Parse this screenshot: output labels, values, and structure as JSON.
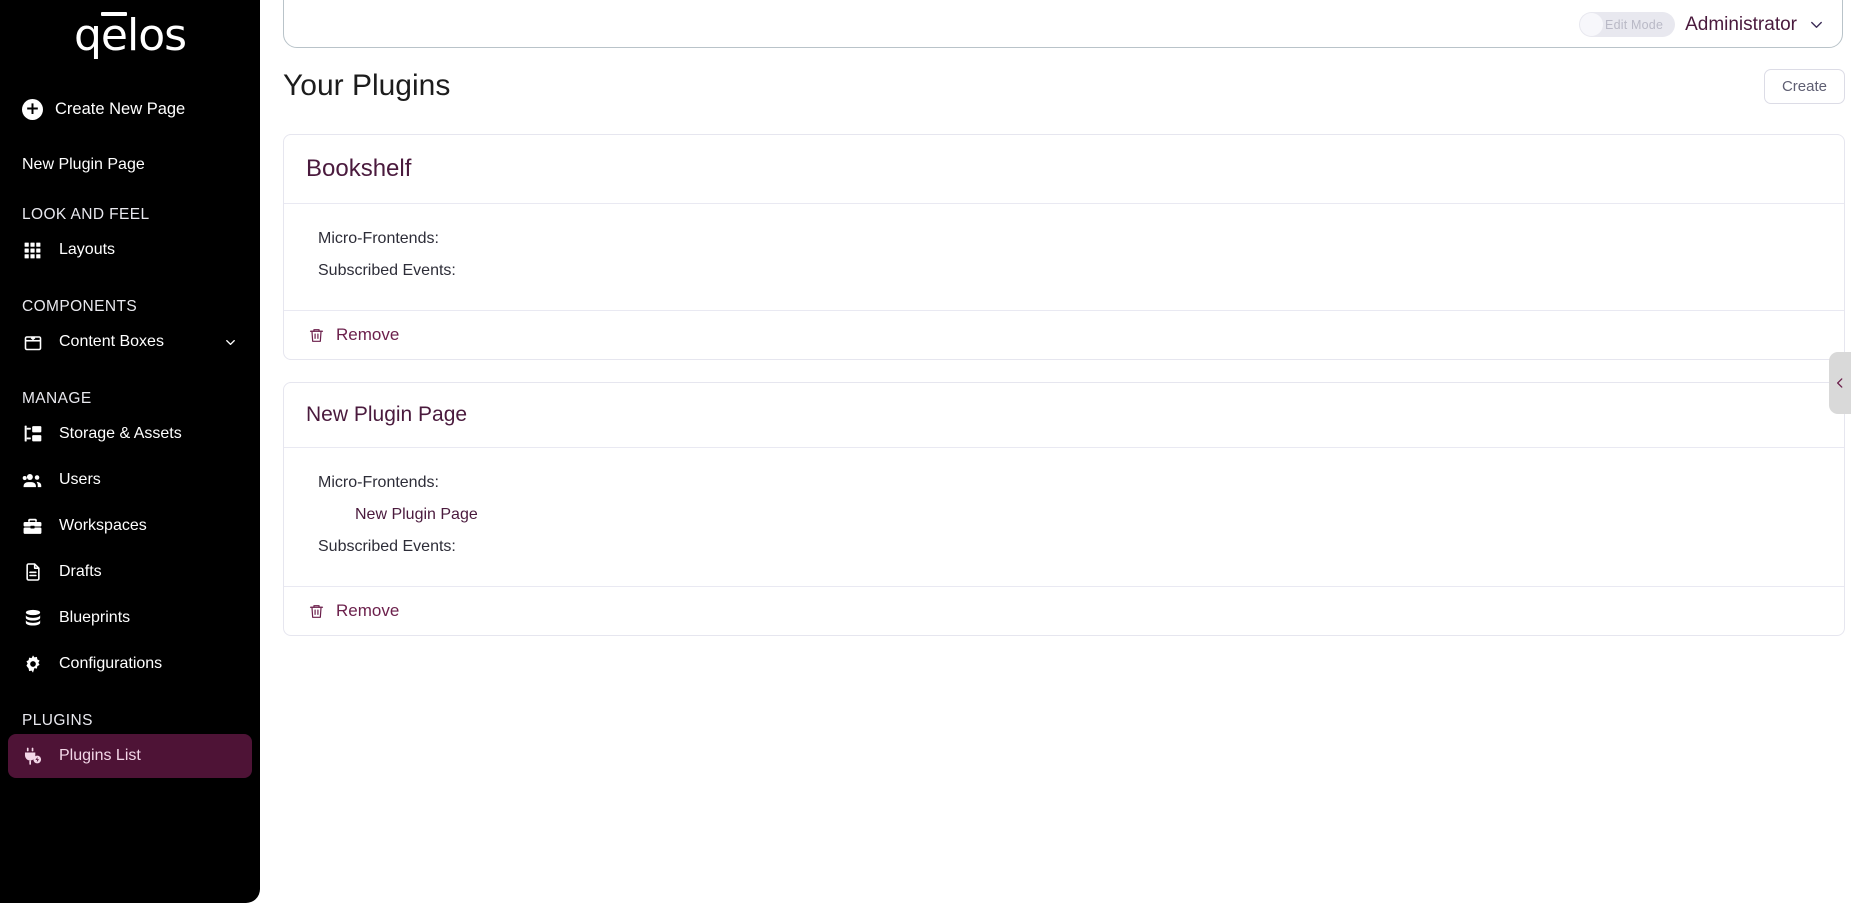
{
  "brand": {
    "logo": "qēlos",
    "accent": "#4a1a3d",
    "active_bg": "#4e1336"
  },
  "sidebar": {
    "create_new_page": "Create New Page",
    "sublink": "New Plugin Page",
    "sections": [
      {
        "label": "LOOK AND FEEL"
      },
      {
        "label": "COMPONENTS"
      },
      {
        "label": "MANAGE"
      },
      {
        "label": "PLUGINS"
      }
    ],
    "items": [
      {
        "label": "Layouts",
        "icon": "grid-icon"
      },
      {
        "label": "Content Boxes",
        "icon": "box-icon",
        "chevron": true
      },
      {
        "label": "Storage & Assets",
        "icon": "folder-tree-icon"
      },
      {
        "label": "Users",
        "icon": "users-icon"
      },
      {
        "label": "Workspaces",
        "icon": "briefcase-icon"
      },
      {
        "label": "Drafts",
        "icon": "document-icon"
      },
      {
        "label": "Blueprints",
        "icon": "database-icon"
      },
      {
        "label": "Configurations",
        "icon": "gear-icon"
      },
      {
        "label": "Plugins List",
        "icon": "plug-icon",
        "active": true
      }
    ]
  },
  "topbar": {
    "edit_mode_label": "Edit Mode",
    "edit_mode_on": false,
    "user": "Administrator"
  },
  "main": {
    "title": "Your Plugins",
    "create_label": "Create",
    "labels": {
      "micro_frontends": "Micro-Frontends:",
      "subscribed_events": "Subscribed Events:",
      "remove": "Remove"
    },
    "plugins": [
      {
        "name": "Bookshelf",
        "micro_frontends": [],
        "subscribed_events": []
      },
      {
        "name": "New Plugin Page",
        "micro_frontends": [
          "New Plugin Page"
        ],
        "subscribed_events": []
      }
    ]
  }
}
